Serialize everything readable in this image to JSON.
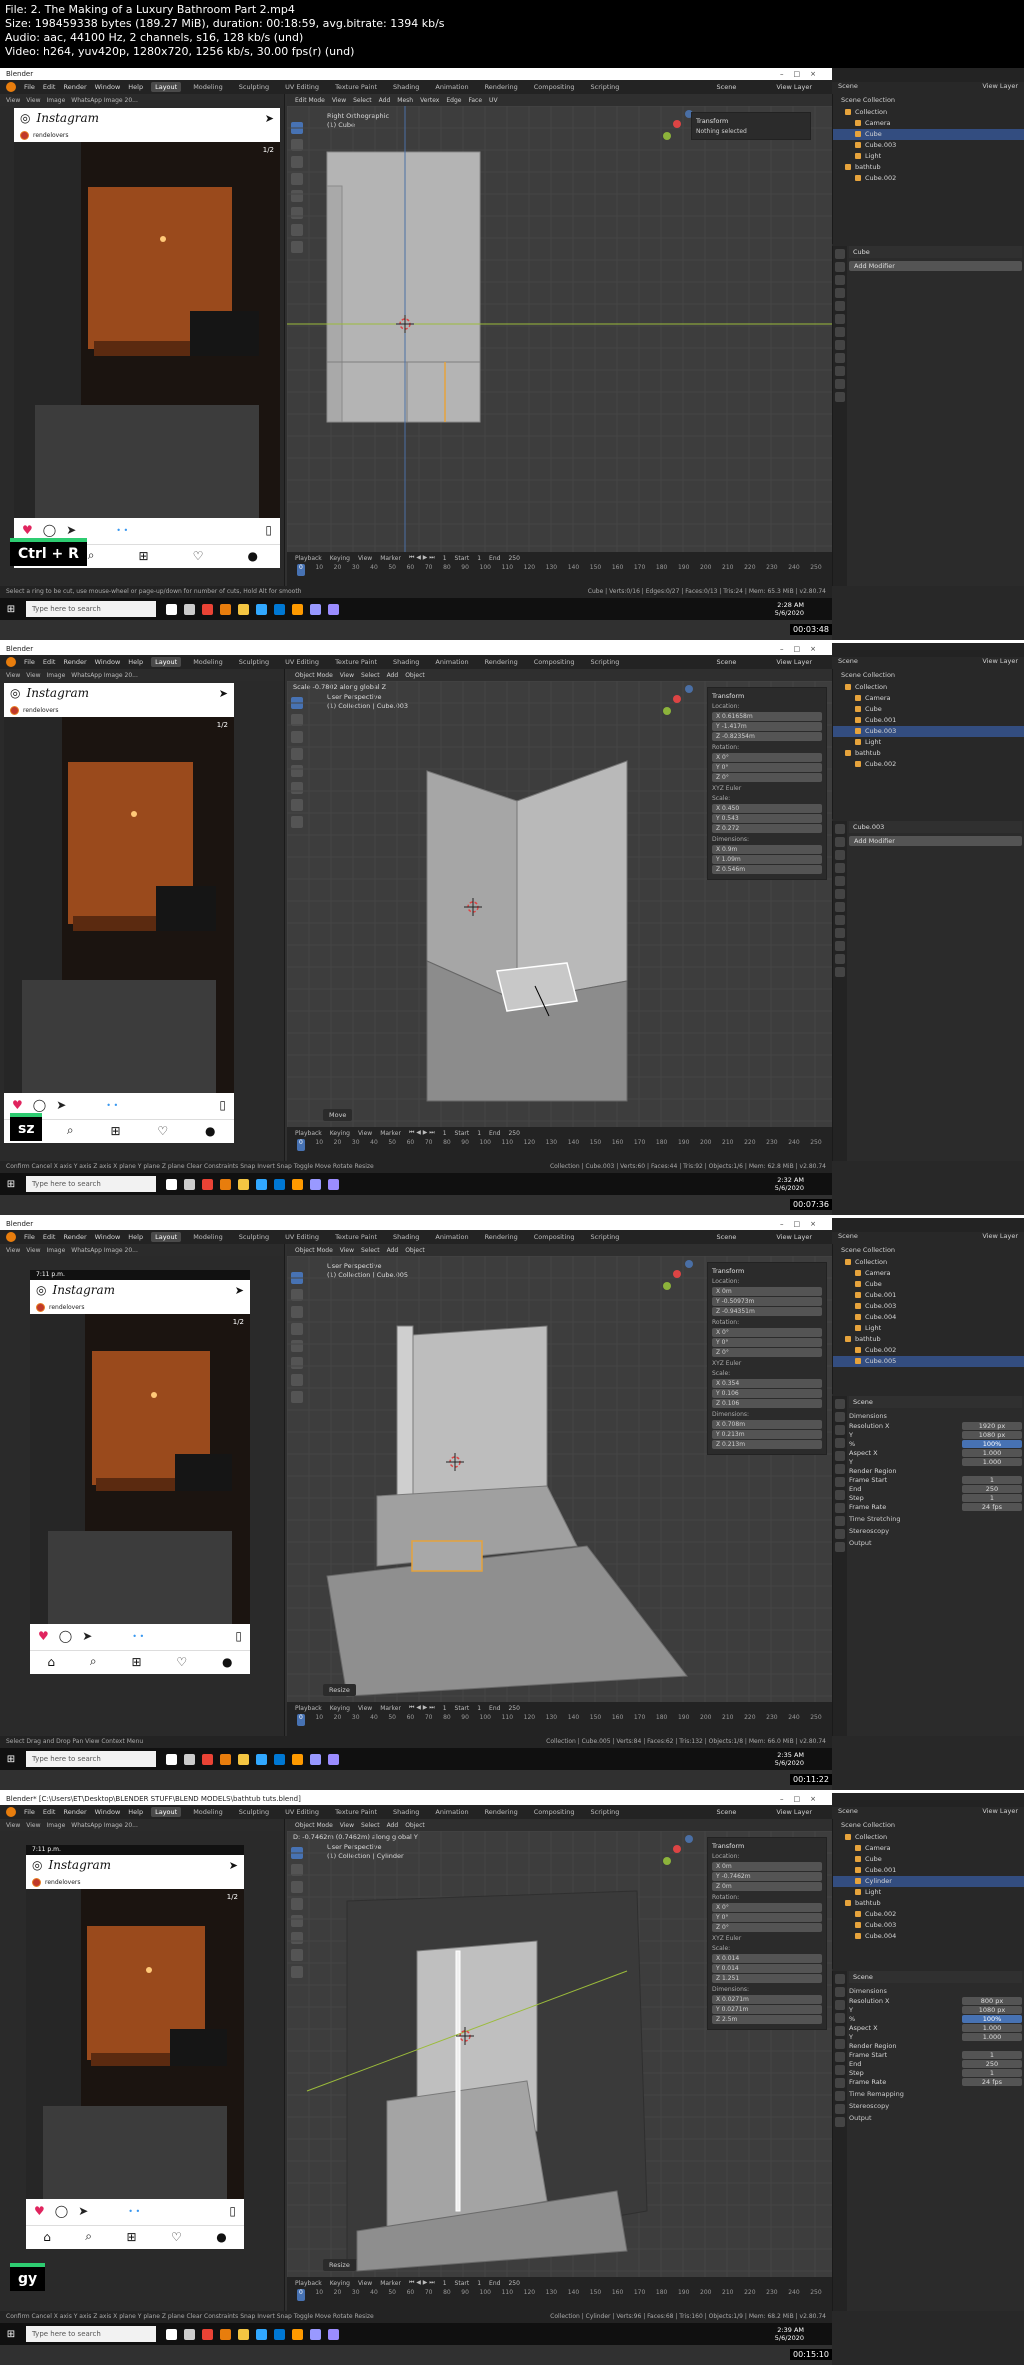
{
  "info": {
    "line1": "File: 2. The Making of a Luxury Bathroom Part 2.mp4",
    "line2": "Size: 198459338 bytes (189.27 MiB), duration: 00:18:59, avg.bitrate: 1394 kb/s",
    "line3": "Audio: aac, 44100 Hz, 2 channels, s16, 128 kb/s (und)",
    "line4": "Video: h264, yuv420p, 1280x720, 1256 kb/s, 30.00 fps(r) (und)"
  },
  "common": {
    "menus": [
      "File",
      "Edit",
      "Render",
      "Window",
      "Help"
    ],
    "workspaces": [
      "Layout",
      "Modeling",
      "Sculpting",
      "UV Editing",
      "Texture Paint",
      "Shading",
      "Animation",
      "Rendering",
      "Compositing",
      "Scripting"
    ],
    "scene_label": "Scene",
    "view_layer_label": "View Layer",
    "ref_menus": [
      "View",
      "View",
      "Image"
    ],
    "ref_image_name": "WhatsApp Image 20...",
    "ig_brand": "Instagram",
    "ig_user": "rendelovers",
    "ig_page": "1/2",
    "ig_time": "7:11 p.m.",
    "timeline_menus": [
      "Playback",
      "Keying",
      "View",
      "Marker"
    ],
    "ruler": [
      "0",
      "10",
      "20",
      "30",
      "40",
      "50",
      "60",
      "70",
      "80",
      "90",
      "100",
      "110",
      "120",
      "130",
      "140",
      "150",
      "160",
      "170",
      "180",
      "190",
      "200",
      "210",
      "220",
      "230",
      "240",
      "250"
    ],
    "current_frame": "1",
    "start_label": "Start",
    "start_value": "1",
    "end_label": "End",
    "end_value": "250",
    "search_placeholder": "Type here to search",
    "accent": "#4772b3",
    "taskbar_icons": [
      "cortana-icon",
      "task-view-icon",
      "chrome-icon",
      "blender-icon",
      "explorer-icon",
      "photoshop-icon",
      "edge-icon",
      "illustrator-icon",
      "premiere-icon",
      "after-effects-icon"
    ],
    "outliner_header": "Scene Collection",
    "transform_title": "Transform",
    "location_label": "Location:",
    "rotation_label": "Rotation:",
    "scale_label": "Scale:",
    "dimensions_label": "Dimensions:",
    "euler_label": "XYZ Euler"
  },
  "frames": [
    {
      "title": "Blender",
      "mode": "Edit Mode",
      "view_menus": [
        "View",
        "Select",
        "Add",
        "Mesh",
        "Vertex",
        "Edge",
        "Face",
        "UV"
      ],
      "viewport_name": "Right Orthographic",
      "viewport_object": "(1) Cube",
      "transform_status": "Nothing selected",
      "key_overlay": "Ctrl + R",
      "outliner": [
        "Collection",
        "Camera",
        "Cube",
        "Cube.003",
        "Light",
        "bathtub",
        "Cube.002"
      ],
      "outliner_selected": "Cube",
      "props_name": "Cube",
      "props_button": "Add Modifier",
      "status_left": "Select a ring to be cut, use mouse-wheel or page-up/down for number of cuts, Hold Alt for smooth",
      "status_right": "Cube | Verts:0/16 | Edges:0/27 | Faces:0/13 | Tris:24 | Mem: 65.3 MiB | v2.80.74",
      "clock_time": "2:28 AM",
      "clock_date": "5/6/2020",
      "counter": "00:03:48"
    },
    {
      "title": "Blender",
      "mode": "Object Mode",
      "header_op": "Scale -0.7802 along global Z",
      "viewport_name": "User Perspective",
      "viewport_object": "(1) Collection | Cube.003",
      "key_overlay": "sz",
      "location": [
        "X 0.61658m",
        "Y -1.417m",
        "Z -0.82354m"
      ],
      "rotation": [
        "X 0°",
        "Y 0°",
        "Z 0°"
      ],
      "scale": [
        "X 0.450",
        "Y 0.543",
        "Z 0.272"
      ],
      "dimensions": [
        "X 0.9m",
        "Y 1.09m",
        "Z 0.546m"
      ],
      "op_box": "Move",
      "outliner": [
        "Collection",
        "Camera",
        "Cube",
        "Cube.001",
        "Cube.003",
        "Light",
        "bathtub",
        "Cube.002"
      ],
      "outliner_selected": "Cube.003",
      "props_name": "Cube.003",
      "props_button": "Add Modifier",
      "status_left": "Confirm   Cancel   X axis   Y axis   Z axis   X plane   Y plane   Z plane   Clear Constraints   Snap Invert   Snap Toggle   Move   Rotate   Resize",
      "status_right": "Collection | Cube.003 | Verts:60 | Faces:44 | Tris:92 | Objects:1/6 | Mem: 62.8 MiB | v2.80.74",
      "clock_time": "2:32 AM",
      "clock_date": "5/6/2020",
      "counter": "00:07:36"
    },
    {
      "title": "Blender",
      "mode": "Object Mode",
      "viewport_name": "User Perspective",
      "viewport_object": "(1) Collection | Cube.005",
      "key_overlay": "",
      "location": [
        "X 0m",
        "Y -0.50973m",
        "Z -0.94351m"
      ],
      "rotation": [
        "X 0°",
        "Y 0°",
        "Z 0°"
      ],
      "scale": [
        "X 0.354",
        "Y 0.106",
        "Z 0.106"
      ],
      "dimensions": [
        "X 0.708m",
        "Y 0.213m",
        "Z 0.213m"
      ],
      "op_box": "Resize",
      "outliner": [
        "Collection",
        "Camera",
        "Cube",
        "Cube.001",
        "Cube.003",
        "Cube.004",
        "Light",
        "bathtub",
        "Cube.002",
        "Cube.005"
      ],
      "outliner_selected": "Cube.005",
      "props_name": "Scene",
      "props_section": "Dimensions",
      "props_rows": [
        [
          "Resolution X",
          "1920 px"
        ],
        [
          "Y",
          "1080 px"
        ],
        [
          "%",
          "100%"
        ],
        [
          "Aspect X",
          "1.000"
        ],
        [
          "Y",
          "1.000"
        ],
        [
          "Render Region",
          ""
        ],
        [
          "Frame Start",
          "1"
        ],
        [
          "End",
          "250"
        ],
        [
          "Step",
          "1"
        ],
        [
          "Frame Rate",
          "24 fps"
        ]
      ],
      "props_extra": [
        "Time Stretching",
        "Stereoscopy",
        "Output"
      ],
      "status_left": "Select     Drag and Drop     Pan View     Context Menu",
      "status_right": "Collection | Cube.005 | Verts:84 | Faces:62 | Tris:132 | Objects:1/8 | Mem: 66.0 MiB | v2.80.74",
      "clock_time": "2:35 AM",
      "clock_date": "5/6/2020",
      "counter": "00:11:22"
    },
    {
      "title": "Blender* [C:\\Users\\ET\\Desktop\\BLENDER STUFF\\BLEND MODELS\\bathtub tuts.blend]",
      "mode": "Object Mode",
      "header_op": "D: -0.7462m (0.7462m) along global Y",
      "viewport_name": "User Perspective",
      "viewport_object": "(1) Collection | Cylinder",
      "key_overlay": "gy",
      "location": [
        "X 0m",
        "Y -0.7462m",
        "Z 0m"
      ],
      "rotation": [
        "X 0°",
        "Y 0°",
        "Z 0°"
      ],
      "scale": [
        "X 0.014",
        "Y 0.014",
        "Z 1.251"
      ],
      "dimensions": [
        "X 0.0271m",
        "Y 0.0271m",
        "Z 2.5m"
      ],
      "op_box": "Resize",
      "outliner": [
        "Collection",
        "Camera",
        "Cube",
        "Cube.001",
        "Cylinder",
        "Light",
        "bathtub",
        "Cube.002",
        "Cube.003",
        "Cube.004"
      ],
      "outliner_selected": "Cylinder",
      "props_name": "Scene",
      "props_section": "Dimensions",
      "props_rows": [
        [
          "Resolution X",
          "800 px"
        ],
        [
          "Y",
          "1080 px"
        ],
        [
          "%",
          "100%"
        ],
        [
          "Aspect X",
          "1.000"
        ],
        [
          "Y",
          "1.000"
        ],
        [
          "Render Region",
          ""
        ],
        [
          "Frame Start",
          "1"
        ],
        [
          "End",
          "250"
        ],
        [
          "Step",
          "1"
        ],
        [
          "Frame Rate",
          "24 fps"
        ]
      ],
      "props_extra": [
        "Time Remapping",
        "Stereoscopy",
        "Output"
      ],
      "status_left": "Confirm   Cancel   X axis   Y axis   Z axis   X plane   Y plane   Z plane   Clear Constraints   Snap Invert   Snap Toggle   Move   Rotate   Resize",
      "status_right": "Collection | Cylinder | Verts:96 | Faces:68 | Tris:160 | Objects:1/9 | Mem: 68.2 MiB | v2.80.74",
      "clock_time": "2:39 AM",
      "clock_date": "5/6/2020",
      "counter": "00:15:10"
    }
  ]
}
